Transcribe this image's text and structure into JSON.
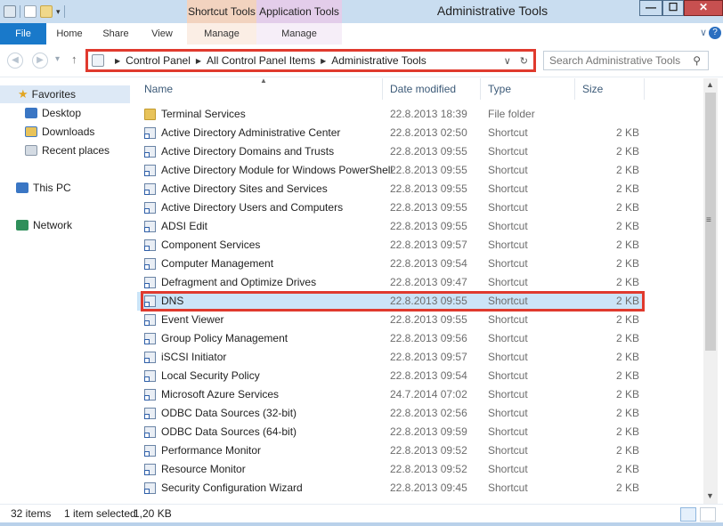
{
  "window": {
    "title": "Administrative Tools",
    "min": "—",
    "max": "☐",
    "close": "✕"
  },
  "context_tabs": {
    "shortcut_tools": "Shortcut Tools",
    "application_tools": "Application Tools"
  },
  "ribbon": {
    "file": "File",
    "home": "Home",
    "share": "Share",
    "view": "View",
    "manage1": "Manage",
    "manage2": "Manage",
    "help": "?"
  },
  "address": {
    "crumbs": [
      "Control Panel",
      "All Control Panel Items",
      "Administrative Tools"
    ]
  },
  "search": {
    "placeholder": "Search Administrative Tools"
  },
  "navpane": {
    "favorites": "Favorites",
    "desktop": "Desktop",
    "downloads": "Downloads",
    "recent": "Recent places",
    "thispc": "This PC",
    "network": "Network"
  },
  "columns": {
    "name": "Name",
    "date": "Date modified",
    "type": "Type",
    "size": "Size"
  },
  "files": [
    {
      "name": "Terminal Services",
      "date": "22.8.2013 18:39",
      "type": "File folder",
      "size": "",
      "kind": "folder"
    },
    {
      "name": "Active Directory Administrative Center",
      "date": "22.8.2013 02:50",
      "type": "Shortcut",
      "size": "2 KB",
      "kind": "shortcut"
    },
    {
      "name": "Active Directory Domains and Trusts",
      "date": "22.8.2013 09:55",
      "type": "Shortcut",
      "size": "2 KB",
      "kind": "shortcut"
    },
    {
      "name": "Active Directory Module for Windows PowerShell",
      "date": "22.8.2013 09:55",
      "type": "Shortcut",
      "size": "2 KB",
      "kind": "shortcut"
    },
    {
      "name": "Active Directory Sites and Services",
      "date": "22.8.2013 09:55",
      "type": "Shortcut",
      "size": "2 KB",
      "kind": "shortcut"
    },
    {
      "name": "Active Directory Users and Computers",
      "date": "22.8.2013 09:55",
      "type": "Shortcut",
      "size": "2 KB",
      "kind": "shortcut"
    },
    {
      "name": "ADSI Edit",
      "date": "22.8.2013 09:55",
      "type": "Shortcut",
      "size": "2 KB",
      "kind": "shortcut"
    },
    {
      "name": "Component Services",
      "date": "22.8.2013 09:57",
      "type": "Shortcut",
      "size": "2 KB",
      "kind": "shortcut"
    },
    {
      "name": "Computer Management",
      "date": "22.8.2013 09:54",
      "type": "Shortcut",
      "size": "2 KB",
      "kind": "shortcut"
    },
    {
      "name": "Defragment and Optimize Drives",
      "date": "22.8.2013 09:47",
      "type": "Shortcut",
      "size": "2 KB",
      "kind": "shortcut"
    },
    {
      "name": "DNS",
      "date": "22.8.2013 09:55",
      "type": "Shortcut",
      "size": "2 KB",
      "kind": "shortcut",
      "selected": true
    },
    {
      "name": "Event Viewer",
      "date": "22.8.2013 09:55",
      "type": "Shortcut",
      "size": "2 KB",
      "kind": "shortcut"
    },
    {
      "name": "Group Policy Management",
      "date": "22.8.2013 09:56",
      "type": "Shortcut",
      "size": "2 KB",
      "kind": "shortcut"
    },
    {
      "name": "iSCSI Initiator",
      "date": "22.8.2013 09:57",
      "type": "Shortcut",
      "size": "2 KB",
      "kind": "shortcut"
    },
    {
      "name": "Local Security Policy",
      "date": "22.8.2013 09:54",
      "type": "Shortcut",
      "size": "2 KB",
      "kind": "shortcut"
    },
    {
      "name": "Microsoft Azure Services",
      "date": "24.7.2014 07:02",
      "type": "Shortcut",
      "size": "2 KB",
      "kind": "shortcut"
    },
    {
      "name": "ODBC Data Sources (32-bit)",
      "date": "22.8.2013 02:56",
      "type": "Shortcut",
      "size": "2 KB",
      "kind": "shortcut"
    },
    {
      "name": "ODBC Data Sources (64-bit)",
      "date": "22.8.2013 09:59",
      "type": "Shortcut",
      "size": "2 KB",
      "kind": "shortcut"
    },
    {
      "name": "Performance Monitor",
      "date": "22.8.2013 09:52",
      "type": "Shortcut",
      "size": "2 KB",
      "kind": "shortcut"
    },
    {
      "name": "Resource Monitor",
      "date": "22.8.2013 09:52",
      "type": "Shortcut",
      "size": "2 KB",
      "kind": "shortcut"
    },
    {
      "name": "Security Configuration Wizard",
      "date": "22.8.2013 09:45",
      "type": "Shortcut",
      "size": "2 KB",
      "kind": "shortcut"
    }
  ],
  "status": {
    "count": "32 items",
    "selected": "1 item selected",
    "size": "1,20 KB"
  },
  "colors": {
    "accent": "#1979ca",
    "highlight_box": "#e03a2e",
    "selection": "#cce4f7"
  }
}
